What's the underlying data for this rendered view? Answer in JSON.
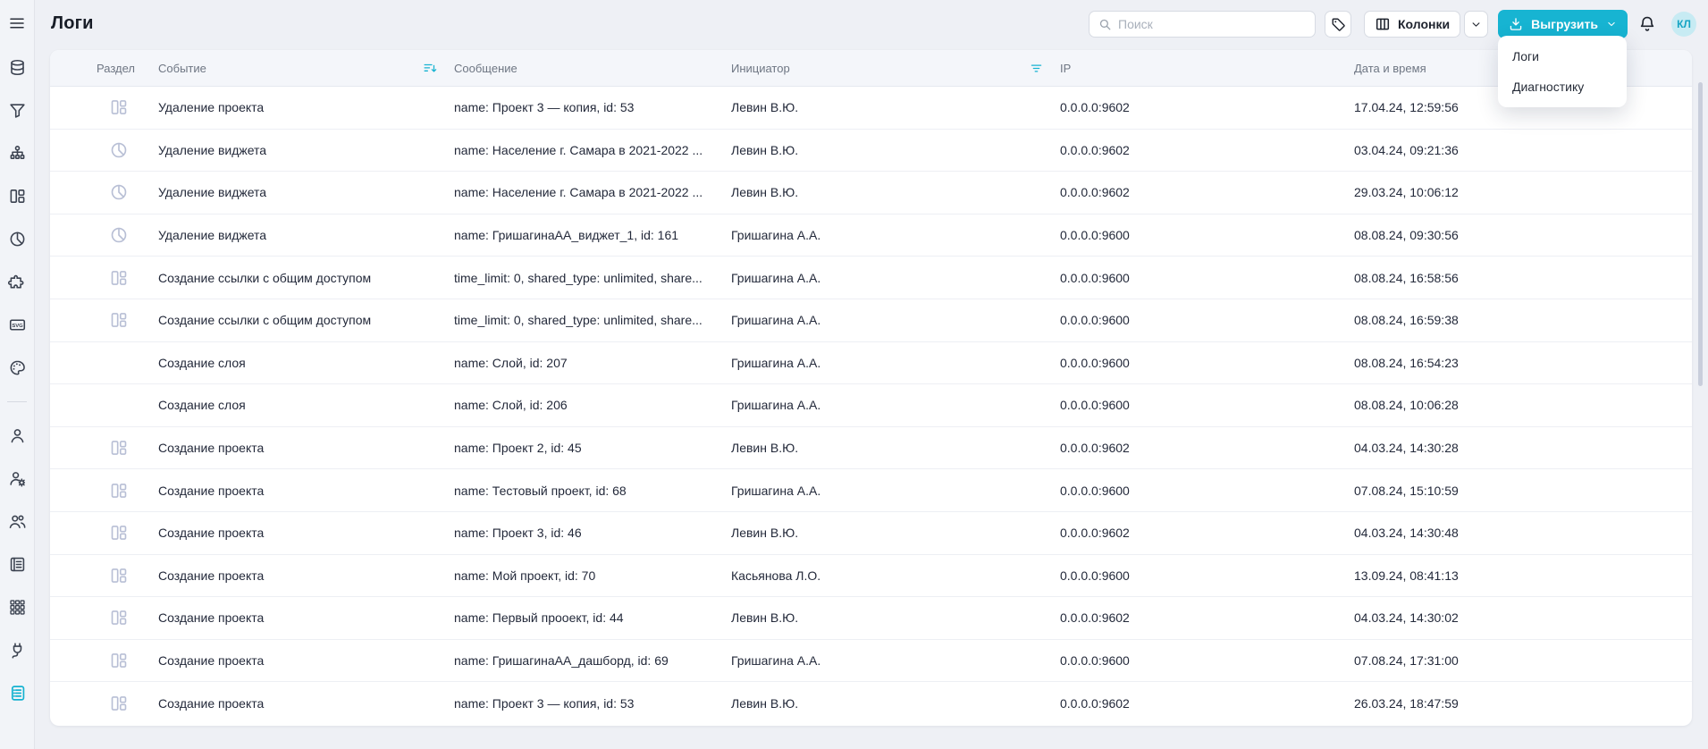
{
  "page_title": "Логи",
  "accent_color": "#17b4d2",
  "topbar": {
    "search_placeholder": "Поиск",
    "columns_label": "Колонки",
    "export_label": "Выгрузить",
    "avatar_initials": "КЛ"
  },
  "export_menu": {
    "items": [
      "Логи",
      "Диагностику"
    ]
  },
  "sidebar": {
    "items": [
      {
        "name": "database-icon"
      },
      {
        "name": "filter-icon"
      },
      {
        "name": "sitemap-icon"
      },
      {
        "name": "dashboard-icon"
      },
      {
        "name": "pie-chart-icon"
      },
      {
        "name": "puzzle-icon"
      },
      {
        "name": "svg-icon"
      },
      {
        "name": "palette-icon"
      },
      {
        "divider": true
      },
      {
        "name": "user-icon"
      },
      {
        "name": "user-settings-icon"
      },
      {
        "name": "users-icon"
      },
      {
        "name": "journal-icon"
      },
      {
        "name": "apps-grid-icon"
      },
      {
        "name": "plug-icon"
      },
      {
        "name": "logs-icon",
        "active": true
      }
    ]
  },
  "table": {
    "columns": [
      "Раздел",
      "Событие",
      "Сообщение",
      "Инициатор",
      "IP",
      "Дата и время"
    ],
    "header_icons": {
      "event_column": "sort-descending-icon",
      "initiator_column": "filter-applied-icon"
    },
    "rows": [
      {
        "section_icon": "dashboard-icon",
        "event": "Удаление проекта",
        "message": "name: Проект 3 — копия, id: 53",
        "initiator": "Левин В.Ю.",
        "ip": "0.0.0.0:9602",
        "datetime": "17.04.24, 12:59:56"
      },
      {
        "section_icon": "pie-chart-icon",
        "event": "Удаление виджета",
        "message": "name: Население г. Самара в 2021-2022 ...",
        "initiator": "Левин В.Ю.",
        "ip": "0.0.0.0:9602",
        "datetime": "03.04.24, 09:21:36"
      },
      {
        "section_icon": "pie-chart-icon",
        "event": "Удаление виджета",
        "message": "name: Население г. Самара в 2021-2022 ...",
        "initiator": "Левин В.Ю.",
        "ip": "0.0.0.0:9602",
        "datetime": "29.03.24, 10:06:12"
      },
      {
        "section_icon": "pie-chart-icon",
        "event": "Удаление виджета",
        "message": "name: ГришагинаАА_виджет_1, id: 161",
        "initiator": "Гришагина А.А.",
        "ip": "0.0.0.0:9600",
        "datetime": "08.08.24, 09:30:56"
      },
      {
        "section_icon": "dashboard-icon",
        "event": "Создание ссылки с общим доступом",
        "message": "time_limit: 0, shared_type: unlimited, share...",
        "initiator": "Гришагина А.А.",
        "ip": "0.0.0.0:9600",
        "datetime": "08.08.24, 16:58:56"
      },
      {
        "section_icon": "dashboard-icon",
        "event": "Создание ссылки с общим доступом",
        "message": "time_limit: 0, shared_type: unlimited, share...",
        "initiator": "Гришагина А.А.",
        "ip": "0.0.0.0:9600",
        "datetime": "08.08.24, 16:59:38"
      },
      {
        "section_icon": "",
        "event": "Создание слоя",
        "message": "name: Слой, id: 207",
        "initiator": "Гришагина А.А.",
        "ip": "0.0.0.0:9600",
        "datetime": "08.08.24, 16:54:23"
      },
      {
        "section_icon": "",
        "event": "Создание слоя",
        "message": "name: Слой, id: 206",
        "initiator": "Гришагина А.А.",
        "ip": "0.0.0.0:9600",
        "datetime": "08.08.24, 10:06:28"
      },
      {
        "section_icon": "dashboard-icon",
        "event": "Создание проекта",
        "message": "name: Проект 2, id: 45",
        "initiator": "Левин В.Ю.",
        "ip": "0.0.0.0:9602",
        "datetime": "04.03.24, 14:30:28"
      },
      {
        "section_icon": "dashboard-icon",
        "event": "Создание проекта",
        "message": "name: Тестовый проект, id: 68",
        "initiator": "Гришагина А.А.",
        "ip": "0.0.0.0:9600",
        "datetime": "07.08.24, 15:10:59"
      },
      {
        "section_icon": "dashboard-icon",
        "event": "Создание проекта",
        "message": "name: Проект 3, id: 46",
        "initiator": "Левин В.Ю.",
        "ip": "0.0.0.0:9602",
        "datetime": "04.03.24, 14:30:48"
      },
      {
        "section_icon": "dashboard-icon",
        "event": "Создание проекта",
        "message": "name: Мой проект, id: 70",
        "initiator": "Касьянова Л.О.",
        "ip": "0.0.0.0:9600",
        "datetime": "13.09.24, 08:41:13"
      },
      {
        "section_icon": "dashboard-icon",
        "event": "Создание проекта",
        "message": "name: Первый прооект, id: 44",
        "initiator": "Левин В.Ю.",
        "ip": "0.0.0.0:9602",
        "datetime": "04.03.24, 14:30:02"
      },
      {
        "section_icon": "dashboard-icon",
        "event": "Создание проекта",
        "message": "name: ГришагинаАА_дашборд, id: 69",
        "initiator": "Гришагина А.А.",
        "ip": "0.0.0.0:9600",
        "datetime": "07.08.24, 17:31:00"
      },
      {
        "section_icon": "dashboard-icon",
        "event": "Создание проекта",
        "message": "name: Проект 3 — копия, id: 53",
        "initiator": "Левин В.Ю.",
        "ip": "0.0.0.0:9602",
        "datetime": "26.03.24, 18:47:59"
      }
    ]
  }
}
